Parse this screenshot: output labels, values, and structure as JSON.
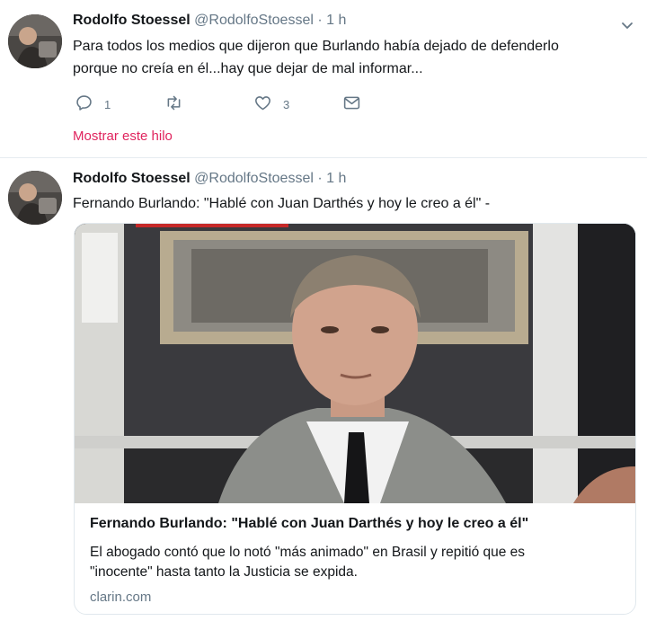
{
  "tweets": [
    {
      "author_name": "Rodolfo Stoessel",
      "handle": "@RodolfoStoessel",
      "separator": "·",
      "time": "1 h",
      "text_line1": "Para todos los medios que dijeron que Burlando había dejado de defenderlo",
      "text_line2": "porque no creía en él...hay que dejar de mal informar...",
      "actions": {
        "replies": "1",
        "retweets": "",
        "likes": "3"
      },
      "thread_link": "Mostrar este hilo",
      "icons": [
        "reply-icon",
        "retweet-icon",
        "like-icon",
        "dm-icon",
        "chevron-down-icon"
      ]
    },
    {
      "author_name": "Rodolfo Stoessel",
      "handle": "@RodolfoStoessel",
      "separator": "·",
      "time": "1 h",
      "text": "Fernando Burlando: \"Hablé con Juan Darthés y hoy le creo a él\" -",
      "card": {
        "title": "Fernando Burlando: \"Hablé con Juan Darthés y hoy le creo a él\"",
        "description_line1": "El abogado contó que lo notó \"más animado\" en Brasil y repitió que es",
        "description_line2": "\"inocente\" hasta tanto la Justicia se expida.",
        "domain": "clarin.com"
      }
    }
  ],
  "colors": {
    "text": "#14171a",
    "secondary": "#657786",
    "thread_link": "#e0245e",
    "divider": "#e6ecf0"
  }
}
